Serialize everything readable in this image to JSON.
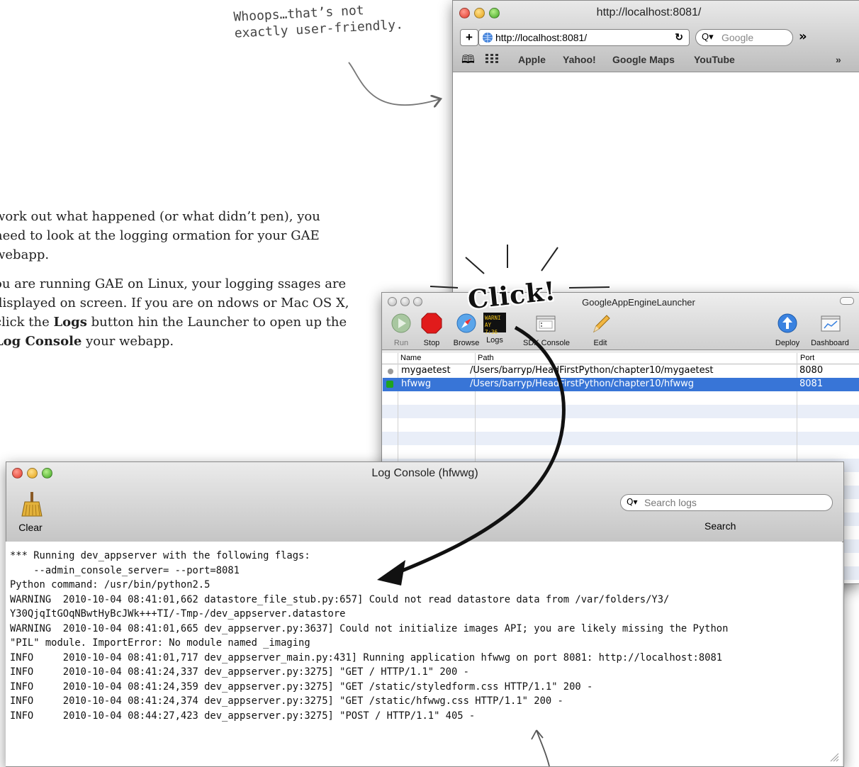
{
  "annotations": {
    "whoops": "Whoops…that’s not\nexactly user-friendly.",
    "click": "Click!"
  },
  "prose": {
    "para1": "work out what happened (or what didn’t pen), you need to look at the logging ormation for your GAE webapp.",
    "para2_pre": "ou are running GAE on Linux, your logging ssages are displayed on screen. If you are on ndows or Mac OS X, click the ",
    "para2_logs": "Logs",
    "para2_mid": " button hin the Launcher to open up the ",
    "para2_console": "Log Console",
    "para2_post": " your webapp."
  },
  "browser": {
    "title": "http://localhost:8081/",
    "add_label": "+",
    "url": "http://localhost:8081/",
    "reload_icon": "reload-icon",
    "search_placeholder": "Google",
    "overflow": "»",
    "bookmarks": [
      "Apple",
      "Yahoo!",
      "Google Maps",
      "YouTube"
    ],
    "bookmarks_overflow": "»"
  },
  "launcher": {
    "title": "GoogleAppEngineLauncher",
    "toolbar": [
      {
        "label": "Run",
        "icon": "run-icon",
        "enabled": false
      },
      {
        "label": "Stop",
        "icon": "stop-icon",
        "enabled": true
      },
      {
        "label": "Browse",
        "icon": "browse-icon",
        "enabled": true
      },
      {
        "label": "Logs",
        "icon": "logs-icon",
        "enabled": true
      },
      {
        "label": "SDK Console",
        "icon": "sdk-console-icon",
        "enabled": true
      },
      {
        "label": "Edit",
        "icon": "edit-icon",
        "enabled": true
      },
      {
        "label": "Deploy",
        "icon": "deploy-icon",
        "enabled": true
      },
      {
        "label": "Dashboard",
        "icon": "dashboard-icon",
        "enabled": true
      }
    ],
    "logs_icon_text": [
      "WARNI",
      "AY 7:36"
    ],
    "columns": {
      "name": "Name",
      "path": "Path",
      "port": "Port"
    },
    "rows": [
      {
        "name": "mygaetest",
        "path": "/Users/barryp/HeadFirstPython/chapter10/mygaetest",
        "port": "8080",
        "selected": false,
        "running": false
      },
      {
        "name": "hfwwg",
        "path": "/Users/barryp/HeadFirstPython/chapter10/hfwwg",
        "port": "8081",
        "selected": true,
        "running": true
      }
    ]
  },
  "log_console": {
    "title": "Log Console (hfwwg)",
    "clear_label": "Clear",
    "search_placeholder": "Search logs",
    "search_label": "Search",
    "lines": [
      "*** Running dev_appserver with the following flags:",
      "    --admin_console_server= --port=8081",
      "Python command: /usr/bin/python2.5",
      "WARNING  2010-10-04 08:41:01,662 datastore_file_stub.py:657] Could not read datastore data from /var/folders/Y3/",
      "Y30QjqItGOqNBwtHyBcJWk+++TI/-Tmp-/dev_appserver.datastore",
      "WARNING  2010-10-04 08:41:01,665 dev_appserver.py:3637] Could not initialize images API; you are likely missing the Python",
      "\"PIL\" module. ImportError: No module named _imaging",
      "INFO     2010-10-04 08:41:01,717 dev_appserver_main.py:431] Running application hfwwg on port 8081: http://localhost:8081",
      "INFO     2010-10-04 08:41:24,337 dev_appserver.py:3275] \"GET / HTTP/1.1\" 200 -",
      "INFO     2010-10-04 08:41:24,359 dev_appserver.py:3275] \"GET /static/styledform.css HTTP/1.1\" 200 -",
      "INFO     2010-10-04 08:41:24,374 dev_appserver.py:3275] \"GET /static/hfwwg.css HTTP/1.1\" 200 -",
      "INFO     2010-10-04 08:44:27,423 dev_appserver.py:3275] \"POST / HTTP/1.1\" 405 -"
    ]
  }
}
